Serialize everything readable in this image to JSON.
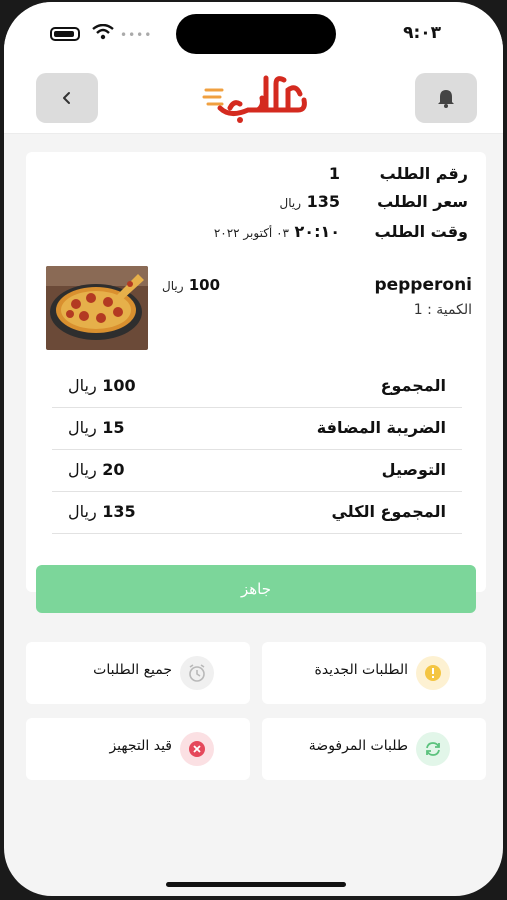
{
  "status_bar": {
    "time": "٩:٠٣"
  },
  "header": {
    "logo_text": "الطلب",
    "icons": {
      "back": "chevron-left-icon",
      "notifications": "bell-icon"
    }
  },
  "order": {
    "number_label": "رقم الطلب",
    "number_value": "1",
    "price_label": "سعر الطلب",
    "price_value": "135",
    "price_currency": "ريال",
    "time_label": "وقت الطلب",
    "time_clock": "٢٠:١٠",
    "time_date": "٠٣ أكتوبر ٢٠٢٢"
  },
  "item": {
    "name": "pepperoni",
    "quantity": "الكمية : 1",
    "price_value": "100",
    "price_currency": "ريال"
  },
  "totals": [
    {
      "label": "المجموع",
      "value": "100",
      "currency": "ريال"
    },
    {
      "label": "الضريبة المضافة",
      "value": "15",
      "currency": "ريال"
    },
    {
      "label": "التوصيل",
      "value": "20",
      "currency": "ريال"
    },
    {
      "label": "المجموع الكلي",
      "value": "135",
      "currency": "ريال"
    }
  ],
  "ready_button": {
    "label": "جاهز",
    "color": "#7cd69a"
  },
  "tiles": [
    {
      "label": "الطلبات الجديدة",
      "icon": "exclamation-icon",
      "color": "#f4c542"
    },
    {
      "label": "جميع الطلبات",
      "icon": "clock-icon",
      "color": "#b8b8b8"
    },
    {
      "label": "طلبات المرفوضة",
      "icon": "refresh-icon",
      "color": "#5cc27e"
    },
    {
      "label": "قيد التجهيز",
      "icon": "close-icon",
      "color": "#e5485b"
    }
  ],
  "colors": {
    "brand": "#d42a1f",
    "accent_green": "#7cd69a"
  }
}
